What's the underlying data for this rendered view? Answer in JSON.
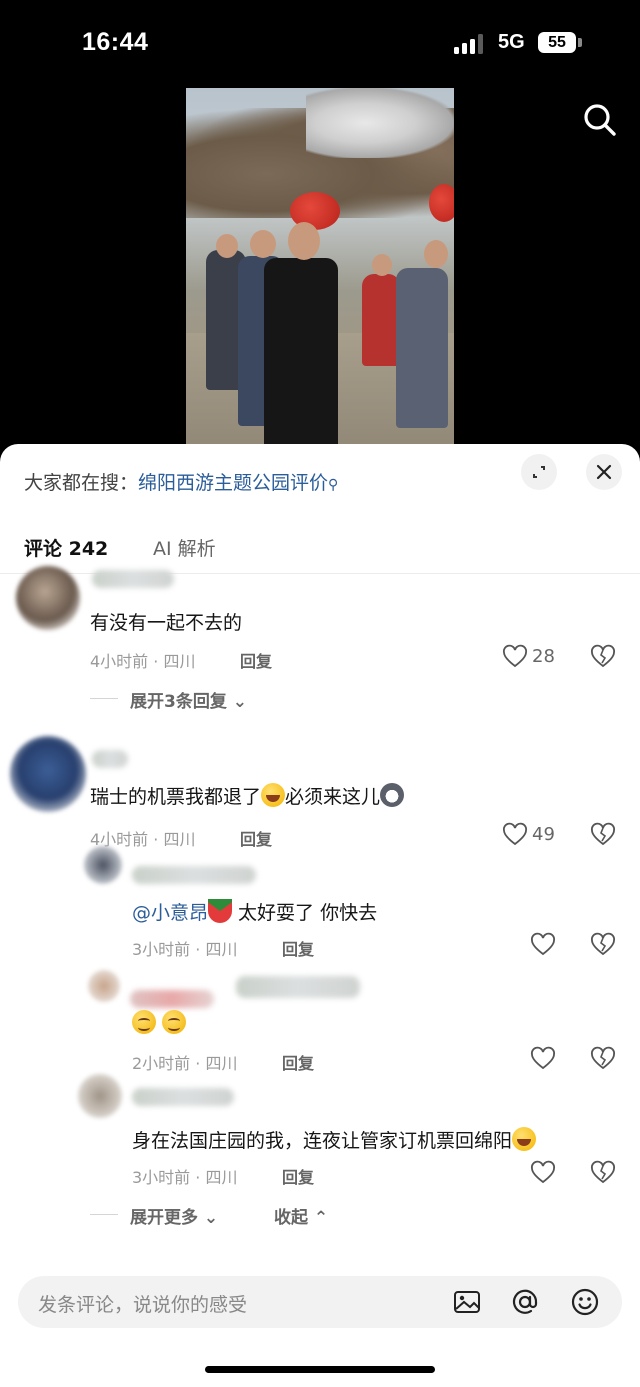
{
  "status_bar": {
    "time": "16:44",
    "network": "5G",
    "battery": "55"
  },
  "hot_search": {
    "prefix": "大家都在搜：",
    "keyword": "绵阳西游主题公园评价"
  },
  "tabs": [
    {
      "label": "评论 242"
    },
    {
      "label": "AI 解析"
    }
  ],
  "comments": [
    {
      "text": "有没有一起不去的",
      "meta": "4小时前 · 四川",
      "reply_label": "回复",
      "likes": "28",
      "expand_label": "展开3条回复"
    },
    {
      "text": "瑞士的机票我都退了",
      "text_after": "必须来这儿",
      "meta": "4小时前 · 四川",
      "reply_label": "回复",
      "likes": "49"
    }
  ],
  "replies": [
    {
      "mention": "@小意昂",
      "text": " 太好耍了 你快去",
      "meta": "3小时前 · 四川",
      "reply_label": "回复"
    },
    {
      "meta": "2小时前 · 四川",
      "reply_label": "回复"
    },
    {
      "text": "身在法国庄园的我，连夜让管家订机票回绵阳",
      "meta": "3小时前 · 四川",
      "reply_label": "回复"
    }
  ],
  "expand_more_label": "展开更多",
  "collapse_label": "收起",
  "input": {
    "placeholder": "发条评论，说说你的感受"
  },
  "icons": {
    "search": "search-icon",
    "expand": "expand-icon",
    "close": "close-icon",
    "like": "heart-icon",
    "dislike": "broken-heart-icon",
    "image": "image-icon",
    "mention": "at-icon",
    "emoji": "smiley-icon"
  }
}
